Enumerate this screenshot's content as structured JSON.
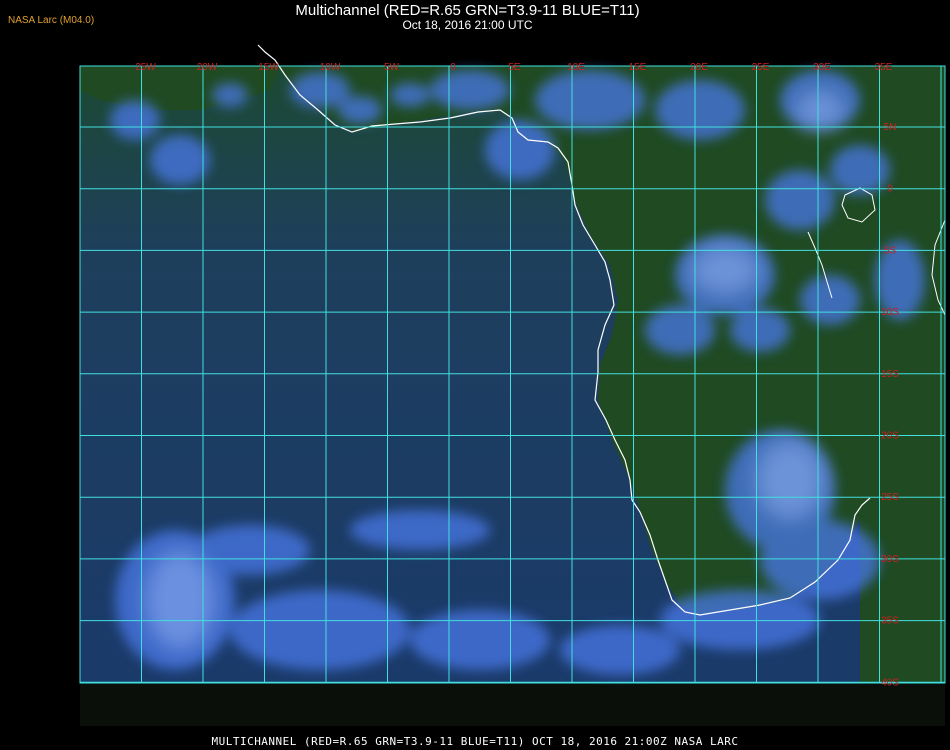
{
  "header": {
    "source_label": "NASA Larc (M04.0)",
    "title": "Multichannel (RED=R.65 GRN=T3.9-11 BLUE=T11)",
    "subtitle": "Oct 18, 2016 21:00 UTC"
  },
  "footer": {
    "caption": "MULTICHANNEL (RED=R.65 GRN=T3.9-11 BLUE=T11) OCT 18, 2016 21:00Z   NASA LARC"
  },
  "map": {
    "colors": {
      "ocean": "#1a3a5a",
      "land": "#1d4a1d",
      "grid": "#40e0e0",
      "coast": "#ffffff",
      "label": "#cc2020",
      "cloud": "#4a78e8"
    },
    "longitude_labels": [
      "25W",
      "20W",
      "15W",
      "10W",
      "5W",
      "0",
      "5E",
      "10E",
      "15E",
      "20E",
      "25E",
      "30E",
      "35E"
    ],
    "latitude_labels": [
      "5N",
      "0",
      "5S",
      "10S",
      "15S",
      "20S",
      "25S",
      "30S",
      "35S",
      "40S"
    ]
  }
}
